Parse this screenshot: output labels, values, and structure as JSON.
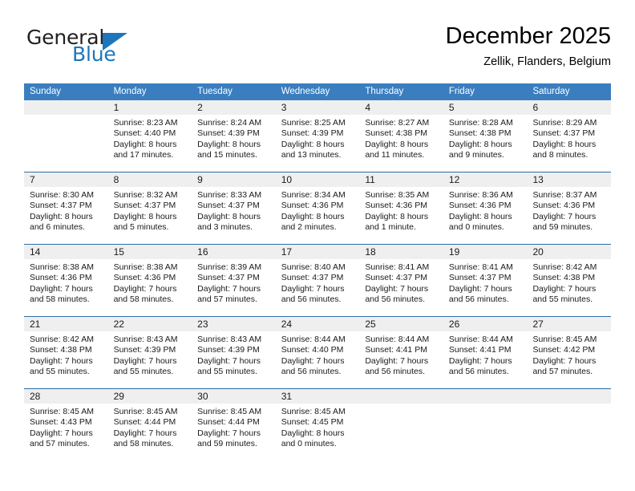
{
  "brand": {
    "word1": "General",
    "word2": "Blue",
    "accent_color": "#1c76bc"
  },
  "header": {
    "title": "December 2025",
    "subtitle": "Zellik, Flanders, Belgium"
  },
  "calendar": {
    "header_color": "#3a7ebf",
    "weekdays": [
      "Sunday",
      "Monday",
      "Tuesday",
      "Wednesday",
      "Thursday",
      "Friday",
      "Saturday"
    ],
    "weeks": [
      [
        {
          "day": "",
          "lines": []
        },
        {
          "day": "1",
          "lines": [
            "Sunrise: 8:23 AM",
            "Sunset: 4:40 PM",
            "Daylight: 8 hours",
            "and 17 minutes."
          ]
        },
        {
          "day": "2",
          "lines": [
            "Sunrise: 8:24 AM",
            "Sunset: 4:39 PM",
            "Daylight: 8 hours",
            "and 15 minutes."
          ]
        },
        {
          "day": "3",
          "lines": [
            "Sunrise: 8:25 AM",
            "Sunset: 4:39 PM",
            "Daylight: 8 hours",
            "and 13 minutes."
          ]
        },
        {
          "day": "4",
          "lines": [
            "Sunrise: 8:27 AM",
            "Sunset: 4:38 PM",
            "Daylight: 8 hours",
            "and 11 minutes."
          ]
        },
        {
          "day": "5",
          "lines": [
            "Sunrise: 8:28 AM",
            "Sunset: 4:38 PM",
            "Daylight: 8 hours",
            "and 9 minutes."
          ]
        },
        {
          "day": "6",
          "lines": [
            "Sunrise: 8:29 AM",
            "Sunset: 4:37 PM",
            "Daylight: 8 hours",
            "and 8 minutes."
          ]
        }
      ],
      [
        {
          "day": "7",
          "lines": [
            "Sunrise: 8:30 AM",
            "Sunset: 4:37 PM",
            "Daylight: 8 hours",
            "and 6 minutes."
          ]
        },
        {
          "day": "8",
          "lines": [
            "Sunrise: 8:32 AM",
            "Sunset: 4:37 PM",
            "Daylight: 8 hours",
            "and 5 minutes."
          ]
        },
        {
          "day": "9",
          "lines": [
            "Sunrise: 8:33 AM",
            "Sunset: 4:37 PM",
            "Daylight: 8 hours",
            "and 3 minutes."
          ]
        },
        {
          "day": "10",
          "lines": [
            "Sunrise: 8:34 AM",
            "Sunset: 4:36 PM",
            "Daylight: 8 hours",
            "and 2 minutes."
          ]
        },
        {
          "day": "11",
          "lines": [
            "Sunrise: 8:35 AM",
            "Sunset: 4:36 PM",
            "Daylight: 8 hours",
            "and 1 minute."
          ]
        },
        {
          "day": "12",
          "lines": [
            "Sunrise: 8:36 AM",
            "Sunset: 4:36 PM",
            "Daylight: 8 hours",
            "and 0 minutes."
          ]
        },
        {
          "day": "13",
          "lines": [
            "Sunrise: 8:37 AM",
            "Sunset: 4:36 PM",
            "Daylight: 7 hours",
            "and 59 minutes."
          ]
        }
      ],
      [
        {
          "day": "14",
          "lines": [
            "Sunrise: 8:38 AM",
            "Sunset: 4:36 PM",
            "Daylight: 7 hours",
            "and 58 minutes."
          ]
        },
        {
          "day": "15",
          "lines": [
            "Sunrise: 8:38 AM",
            "Sunset: 4:36 PM",
            "Daylight: 7 hours",
            "and 58 minutes."
          ]
        },
        {
          "day": "16",
          "lines": [
            "Sunrise: 8:39 AM",
            "Sunset: 4:37 PM",
            "Daylight: 7 hours",
            "and 57 minutes."
          ]
        },
        {
          "day": "17",
          "lines": [
            "Sunrise: 8:40 AM",
            "Sunset: 4:37 PM",
            "Daylight: 7 hours",
            "and 56 minutes."
          ]
        },
        {
          "day": "18",
          "lines": [
            "Sunrise: 8:41 AM",
            "Sunset: 4:37 PM",
            "Daylight: 7 hours",
            "and 56 minutes."
          ]
        },
        {
          "day": "19",
          "lines": [
            "Sunrise: 8:41 AM",
            "Sunset: 4:37 PM",
            "Daylight: 7 hours",
            "and 56 minutes."
          ]
        },
        {
          "day": "20",
          "lines": [
            "Sunrise: 8:42 AM",
            "Sunset: 4:38 PM",
            "Daylight: 7 hours",
            "and 55 minutes."
          ]
        }
      ],
      [
        {
          "day": "21",
          "lines": [
            "Sunrise: 8:42 AM",
            "Sunset: 4:38 PM",
            "Daylight: 7 hours",
            "and 55 minutes."
          ]
        },
        {
          "day": "22",
          "lines": [
            "Sunrise: 8:43 AM",
            "Sunset: 4:39 PM",
            "Daylight: 7 hours",
            "and 55 minutes."
          ]
        },
        {
          "day": "23",
          "lines": [
            "Sunrise: 8:43 AM",
            "Sunset: 4:39 PM",
            "Daylight: 7 hours",
            "and 55 minutes."
          ]
        },
        {
          "day": "24",
          "lines": [
            "Sunrise: 8:44 AM",
            "Sunset: 4:40 PM",
            "Daylight: 7 hours",
            "and 56 minutes."
          ]
        },
        {
          "day": "25",
          "lines": [
            "Sunrise: 8:44 AM",
            "Sunset: 4:41 PM",
            "Daylight: 7 hours",
            "and 56 minutes."
          ]
        },
        {
          "day": "26",
          "lines": [
            "Sunrise: 8:44 AM",
            "Sunset: 4:41 PM",
            "Daylight: 7 hours",
            "and 56 minutes."
          ]
        },
        {
          "day": "27",
          "lines": [
            "Sunrise: 8:45 AM",
            "Sunset: 4:42 PM",
            "Daylight: 7 hours",
            "and 57 minutes."
          ]
        }
      ],
      [
        {
          "day": "28",
          "lines": [
            "Sunrise: 8:45 AM",
            "Sunset: 4:43 PM",
            "Daylight: 7 hours",
            "and 57 minutes."
          ]
        },
        {
          "day": "29",
          "lines": [
            "Sunrise: 8:45 AM",
            "Sunset: 4:44 PM",
            "Daylight: 7 hours",
            "and 58 minutes."
          ]
        },
        {
          "day": "30",
          "lines": [
            "Sunrise: 8:45 AM",
            "Sunset: 4:44 PM",
            "Daylight: 7 hours",
            "and 59 minutes."
          ]
        },
        {
          "day": "31",
          "lines": [
            "Sunrise: 8:45 AM",
            "Sunset: 4:45 PM",
            "Daylight: 8 hours",
            "and 0 minutes."
          ]
        },
        {
          "day": "",
          "lines": []
        },
        {
          "day": "",
          "lines": []
        },
        {
          "day": "",
          "lines": []
        }
      ]
    ]
  }
}
